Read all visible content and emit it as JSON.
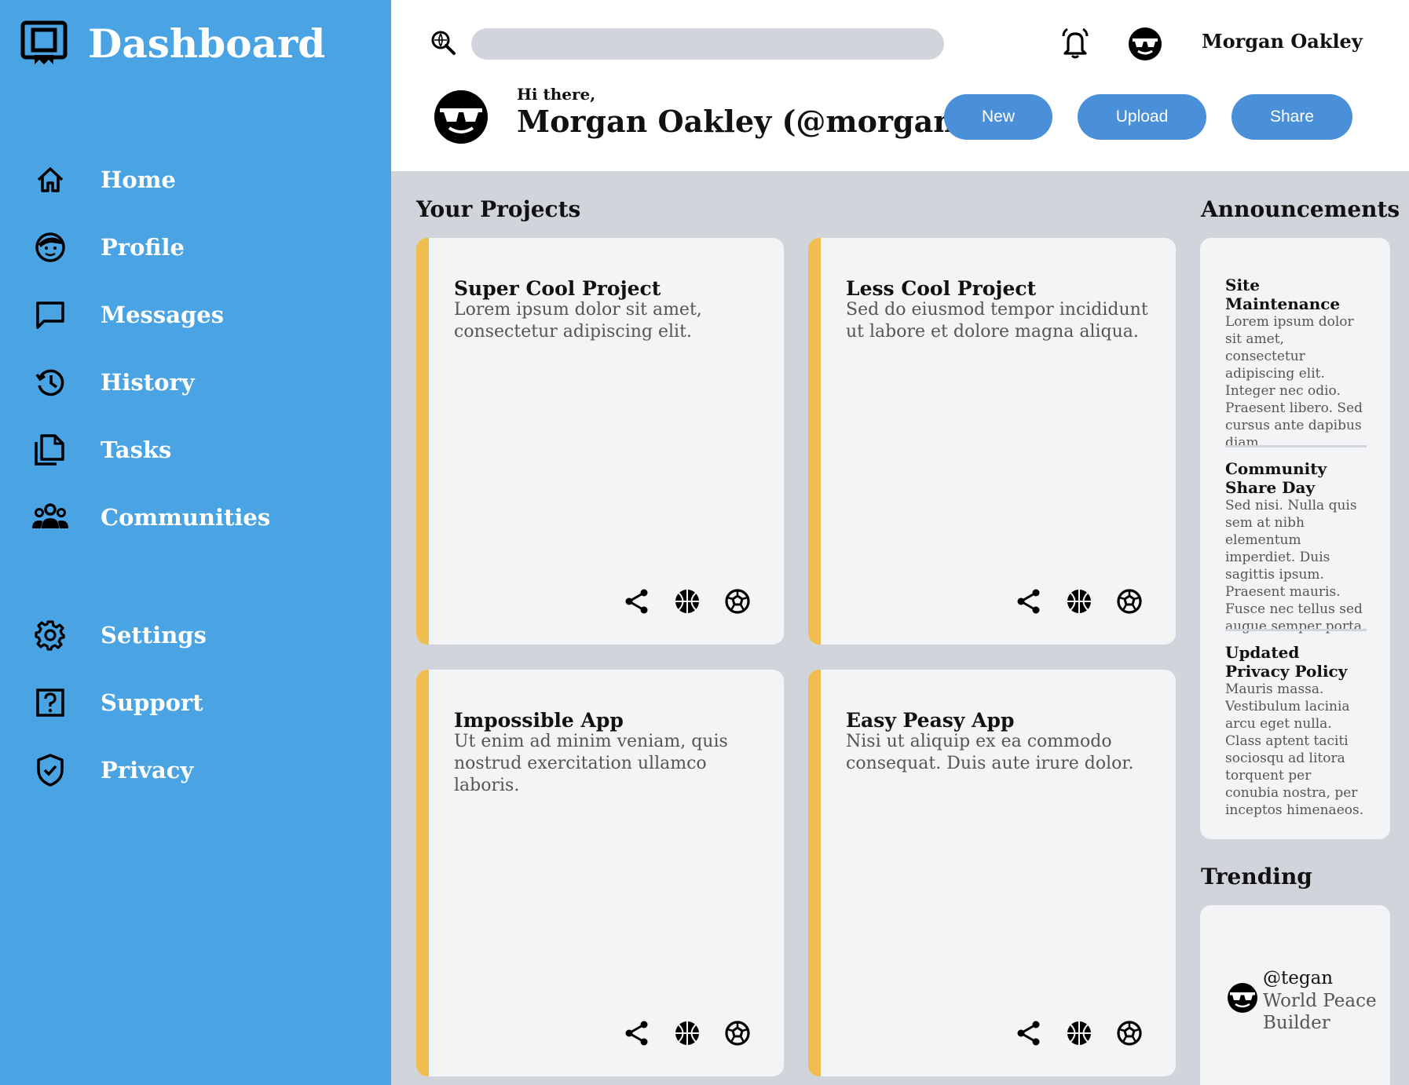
{
  "sidebar": {
    "brand": "Dashboard",
    "items": [
      {
        "label": "Home",
        "icon": "home-icon"
      },
      {
        "label": "Profile",
        "icon": "profile-icon"
      },
      {
        "label": "Messages",
        "icon": "messages-icon"
      },
      {
        "label": "History",
        "icon": "history-icon"
      },
      {
        "label": "Tasks",
        "icon": "tasks-icon"
      },
      {
        "label": "Communities",
        "icon": "communities-icon"
      }
    ],
    "bottom_items": [
      {
        "label": "Settings",
        "icon": "gear-icon"
      },
      {
        "label": "Support",
        "icon": "help-icon"
      },
      {
        "label": "Privacy",
        "icon": "shield-icon"
      }
    ]
  },
  "header": {
    "search_placeholder": "",
    "user_name": "Morgan Oakley",
    "greeting": "Hi there,",
    "display_name": "Morgan Oakley (@morgan)",
    "buttons": {
      "new": "New",
      "upload": "Upload",
      "share": "Share"
    }
  },
  "projects": {
    "title": "Your Projects",
    "items": [
      {
        "title": "Super Cool Project",
        "desc": "Lorem ipsum dolor sit amet, consectetur adipiscing elit."
      },
      {
        "title": "Less Cool Project",
        "desc": "Sed do eiusmod tempor incididunt ut labore et dolore magna aliqua."
      },
      {
        "title": "Impossible App",
        "desc": "Ut enim ad minim veniam, quis nostrud exercitation ullamco laboris."
      },
      {
        "title": "Easy Peasy App",
        "desc": "Nisi ut aliquip ex ea commodo consequat. Duis aute irure dolor."
      }
    ]
  },
  "announcements": {
    "title": "Announcements",
    "items": [
      {
        "title": "Site Maintenance",
        "desc": "Lorem ipsum dolor sit amet, consectetur adipiscing elit. Integer nec odio. Praesent libero. Sed cursus ante dapibus diam."
      },
      {
        "title": "Community Share Day",
        "desc": "Sed nisi. Nulla quis sem at nibh elementum imperdiet. Duis sagittis ipsum. Praesent mauris. Fusce nec tellus sed augue semper porta."
      },
      {
        "title": "Updated Privacy Policy",
        "desc": "Mauris massa. Vestibulum lacinia arcu eget nulla. Class aptent taciti sociosqu ad litora torquent per conubia nostra, per inceptos himenaeos."
      }
    ]
  },
  "trending": {
    "title": "Trending",
    "items": [
      {
        "handle": "@tegan",
        "desc": "World Peace Builder"
      }
    ]
  },
  "colors": {
    "sidebar": "#4aa3e3",
    "button": "#4a90d9",
    "accent_stripe": "#efbe4f",
    "background": "#d1d5db",
    "card": "#f3f4f6"
  }
}
